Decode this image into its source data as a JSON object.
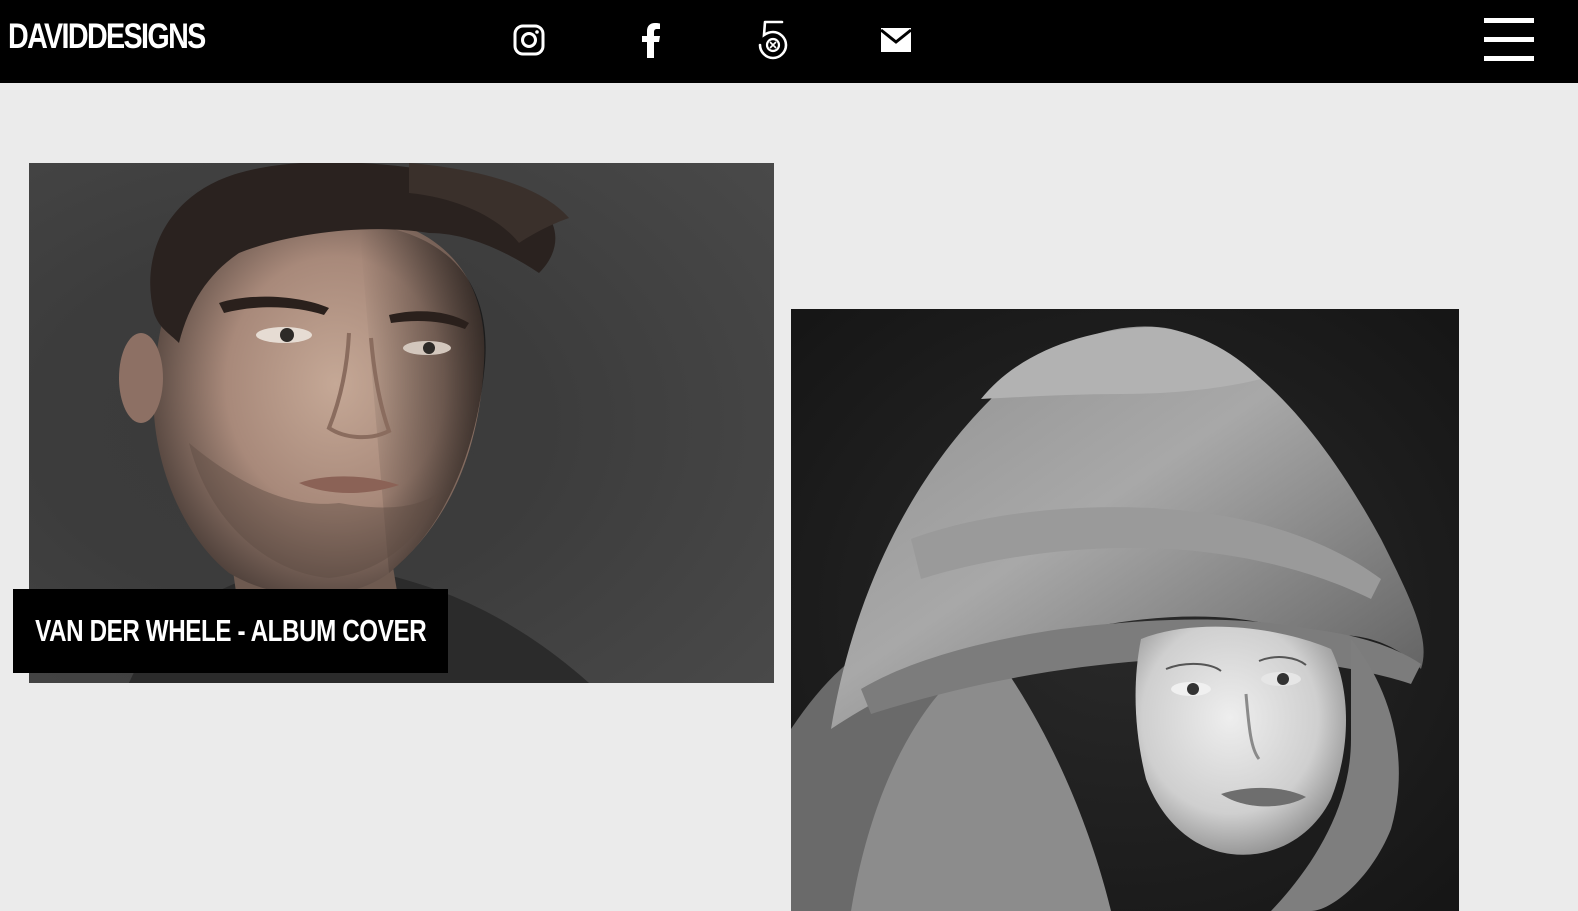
{
  "header": {
    "logo_text": "DAVIDDESIGNS",
    "social_icons": [
      "instagram-icon",
      "facebook-icon",
      "500px-icon",
      "mail-icon"
    ],
    "menu_icon": "hamburger-menu-icon"
  },
  "portfolio": {
    "items": [
      {
        "caption": "VAN DER WHELE - ALBUM COVER",
        "image": "portrait of man with dark hair on dark background"
      },
      {
        "image": "black and white portrait of woman wearing draped fabric hood"
      }
    ]
  },
  "colors": {
    "header_bg": "#000000",
    "page_bg": "#ebebeb",
    "caption_bg": "#000000",
    "text_light": "#ffffff"
  }
}
